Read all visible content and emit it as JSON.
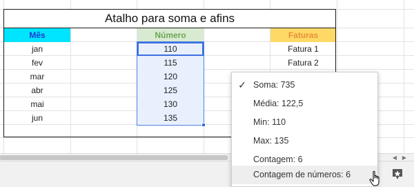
{
  "sheet": {
    "title": "Atalho para soma e afins",
    "headers": {
      "mes": "Mês",
      "numero": "Número",
      "faturas": "Faturas"
    },
    "rows": [
      {
        "mes": "jan",
        "numero": "110",
        "fatura": "Fatura 1"
      },
      {
        "mes": "fev",
        "numero": "115",
        "fatura": "Fatura 2"
      },
      {
        "mes": "mar",
        "numero": "120",
        "fatura": ""
      },
      {
        "mes": "abr",
        "numero": "125",
        "fatura": ""
      },
      {
        "mes": "mai",
        "numero": "130",
        "fatura": ""
      },
      {
        "mes": "jun",
        "numero": "135",
        "fatura": ""
      }
    ],
    "colors": {
      "header_mes_bg": "#00e5ff",
      "header_numero_bg": "#d9ead3",
      "header_faturas_bg": "#ffd966",
      "selection": "#4a7de2"
    }
  },
  "summary_menu": {
    "items": [
      {
        "label": "Soma: 735",
        "checked": true
      },
      {
        "label": "Média: 122,5",
        "checked": false
      },
      {
        "label": "Min: 110",
        "checked": false
      },
      {
        "label": "Max: 135",
        "checked": false
      },
      {
        "label": "Contagem: 6",
        "checked": false
      },
      {
        "label": "Contagem de números: 6",
        "checked": false
      }
    ],
    "check_glyph": "✓"
  },
  "icons": {
    "explore": "explore-icon",
    "cursor": "hand-pointer-icon",
    "scroll_left": "scroll-left-arrow-icon",
    "scroll_right": "scroll-right-arrow-icon"
  }
}
